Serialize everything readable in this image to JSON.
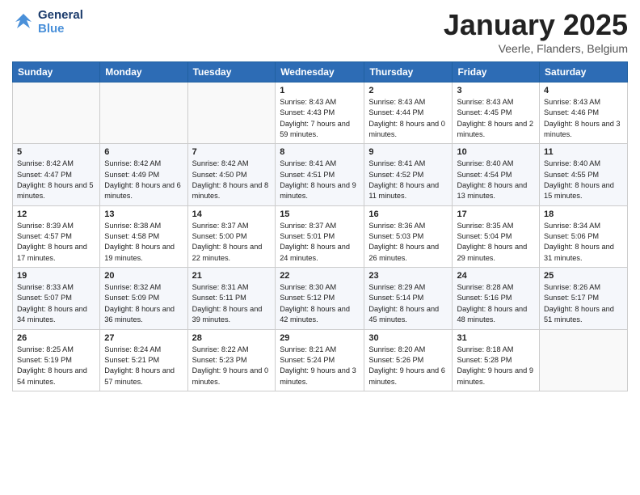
{
  "logo": {
    "line1": "General",
    "line2": "Blue"
  },
  "title": "January 2025",
  "location": "Veerle, Flanders, Belgium",
  "days_of_week": [
    "Sunday",
    "Monday",
    "Tuesday",
    "Wednesday",
    "Thursday",
    "Friday",
    "Saturday"
  ],
  "weeks": [
    [
      {
        "day": "",
        "info": ""
      },
      {
        "day": "",
        "info": ""
      },
      {
        "day": "",
        "info": ""
      },
      {
        "day": "1",
        "info": "Sunrise: 8:43 AM\nSunset: 4:43 PM\nDaylight: 7 hours and 59 minutes."
      },
      {
        "day": "2",
        "info": "Sunrise: 8:43 AM\nSunset: 4:44 PM\nDaylight: 8 hours and 0 minutes."
      },
      {
        "day": "3",
        "info": "Sunrise: 8:43 AM\nSunset: 4:45 PM\nDaylight: 8 hours and 2 minutes."
      },
      {
        "day": "4",
        "info": "Sunrise: 8:43 AM\nSunset: 4:46 PM\nDaylight: 8 hours and 3 minutes."
      }
    ],
    [
      {
        "day": "5",
        "info": "Sunrise: 8:42 AM\nSunset: 4:47 PM\nDaylight: 8 hours and 5 minutes."
      },
      {
        "day": "6",
        "info": "Sunrise: 8:42 AM\nSunset: 4:49 PM\nDaylight: 8 hours and 6 minutes."
      },
      {
        "day": "7",
        "info": "Sunrise: 8:42 AM\nSunset: 4:50 PM\nDaylight: 8 hours and 8 minutes."
      },
      {
        "day": "8",
        "info": "Sunrise: 8:41 AM\nSunset: 4:51 PM\nDaylight: 8 hours and 9 minutes."
      },
      {
        "day": "9",
        "info": "Sunrise: 8:41 AM\nSunset: 4:52 PM\nDaylight: 8 hours and 11 minutes."
      },
      {
        "day": "10",
        "info": "Sunrise: 8:40 AM\nSunset: 4:54 PM\nDaylight: 8 hours and 13 minutes."
      },
      {
        "day": "11",
        "info": "Sunrise: 8:40 AM\nSunset: 4:55 PM\nDaylight: 8 hours and 15 minutes."
      }
    ],
    [
      {
        "day": "12",
        "info": "Sunrise: 8:39 AM\nSunset: 4:57 PM\nDaylight: 8 hours and 17 minutes."
      },
      {
        "day": "13",
        "info": "Sunrise: 8:38 AM\nSunset: 4:58 PM\nDaylight: 8 hours and 19 minutes."
      },
      {
        "day": "14",
        "info": "Sunrise: 8:37 AM\nSunset: 5:00 PM\nDaylight: 8 hours and 22 minutes."
      },
      {
        "day": "15",
        "info": "Sunrise: 8:37 AM\nSunset: 5:01 PM\nDaylight: 8 hours and 24 minutes."
      },
      {
        "day": "16",
        "info": "Sunrise: 8:36 AM\nSunset: 5:03 PM\nDaylight: 8 hours and 26 minutes."
      },
      {
        "day": "17",
        "info": "Sunrise: 8:35 AM\nSunset: 5:04 PM\nDaylight: 8 hours and 29 minutes."
      },
      {
        "day": "18",
        "info": "Sunrise: 8:34 AM\nSunset: 5:06 PM\nDaylight: 8 hours and 31 minutes."
      }
    ],
    [
      {
        "day": "19",
        "info": "Sunrise: 8:33 AM\nSunset: 5:07 PM\nDaylight: 8 hours and 34 minutes."
      },
      {
        "day": "20",
        "info": "Sunrise: 8:32 AM\nSunset: 5:09 PM\nDaylight: 8 hours and 36 minutes."
      },
      {
        "day": "21",
        "info": "Sunrise: 8:31 AM\nSunset: 5:11 PM\nDaylight: 8 hours and 39 minutes."
      },
      {
        "day": "22",
        "info": "Sunrise: 8:30 AM\nSunset: 5:12 PM\nDaylight: 8 hours and 42 minutes."
      },
      {
        "day": "23",
        "info": "Sunrise: 8:29 AM\nSunset: 5:14 PM\nDaylight: 8 hours and 45 minutes."
      },
      {
        "day": "24",
        "info": "Sunrise: 8:28 AM\nSunset: 5:16 PM\nDaylight: 8 hours and 48 minutes."
      },
      {
        "day": "25",
        "info": "Sunrise: 8:26 AM\nSunset: 5:17 PM\nDaylight: 8 hours and 51 minutes."
      }
    ],
    [
      {
        "day": "26",
        "info": "Sunrise: 8:25 AM\nSunset: 5:19 PM\nDaylight: 8 hours and 54 minutes."
      },
      {
        "day": "27",
        "info": "Sunrise: 8:24 AM\nSunset: 5:21 PM\nDaylight: 8 hours and 57 minutes."
      },
      {
        "day": "28",
        "info": "Sunrise: 8:22 AM\nSunset: 5:23 PM\nDaylight: 9 hours and 0 minutes."
      },
      {
        "day": "29",
        "info": "Sunrise: 8:21 AM\nSunset: 5:24 PM\nDaylight: 9 hours and 3 minutes."
      },
      {
        "day": "30",
        "info": "Sunrise: 8:20 AM\nSunset: 5:26 PM\nDaylight: 9 hours and 6 minutes."
      },
      {
        "day": "31",
        "info": "Sunrise: 8:18 AM\nSunset: 5:28 PM\nDaylight: 9 hours and 9 minutes."
      },
      {
        "day": "",
        "info": ""
      }
    ]
  ]
}
